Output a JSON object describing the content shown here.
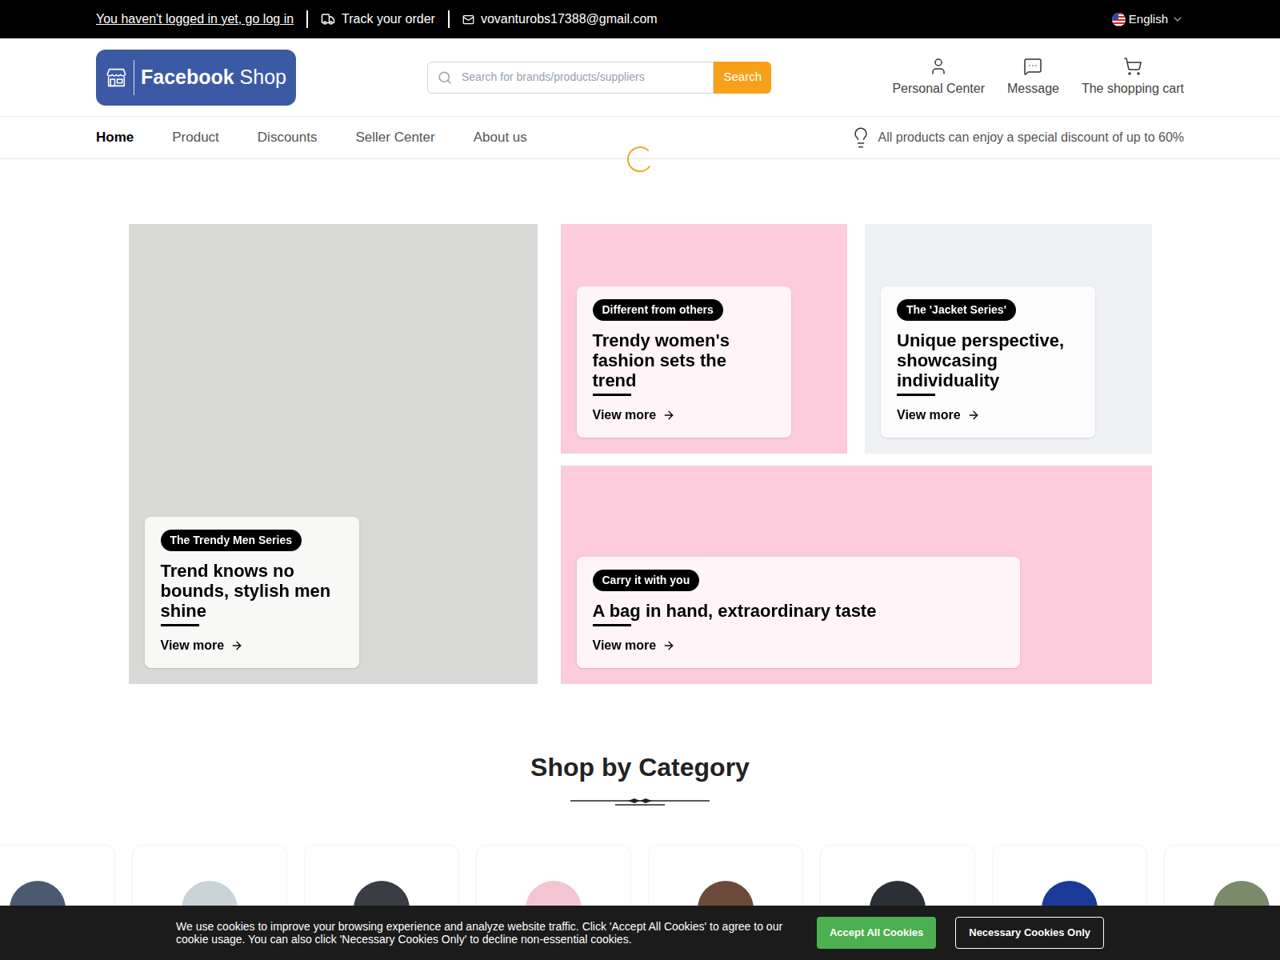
{
  "topbar": {
    "login": "You haven't logged in yet, go log in",
    "track": "Track your order",
    "email": "vovanturobs17388@gmail.com",
    "language": "English"
  },
  "logo": {
    "brand": "Facebook",
    "suffix": "Shop"
  },
  "search": {
    "placeholder": "Search for brands/products/suppliers",
    "button": "Search"
  },
  "header_actions": [
    "Personal Center",
    "Message",
    "The shopping cart"
  ],
  "nav": [
    {
      "label": "Home",
      "selected": true
    },
    {
      "label": "Product",
      "selected": false
    },
    {
      "label": "Discounts",
      "selected": false
    },
    {
      "label": "Seller Center",
      "selected": false
    },
    {
      "label": "About us",
      "selected": false
    }
  ],
  "promo": "All products can enjoy a special discount of up to 60%",
  "loading": true,
  "hero": [
    {
      "badge": "The Trendy Men Series",
      "title": "Trend knows no bounds, stylish men shine",
      "link": "View more",
      "color": "#d9d9d7"
    },
    {
      "badge": "Different from others",
      "title": "Trendy women's fashion sets the trend",
      "link": "View more",
      "color": "#fccbdc"
    },
    {
      "badge": "The 'Jacket Series'",
      "title": "Unique perspective, showcasing individuality",
      "link": "View more",
      "color": "#eef0f4"
    },
    {
      "badge": "Carry it with you",
      "title": "A bag in hand, extraordinary taste",
      "link": "View more",
      "color": "#fccbdc"
    }
  ],
  "category_heading": "Shop by Category",
  "categories": [
    {
      "kind": "photo"
    },
    {
      "kind": "photo"
    },
    {
      "kind": "photo"
    },
    {
      "kind": "photo"
    },
    {
      "kind": "photo"
    },
    {
      "kind": "photo"
    },
    {
      "kind": "photo"
    },
    {
      "kind": "photo"
    }
  ],
  "cookie": {
    "text": "We use cookies to improve your browsing experience and analyze website traffic. Click 'Accept All Cookies' to agree to our cookie usage. You can also click 'Necessary Cookies Only' to decline non-essential cookies.",
    "accept": "Accept All Cookies",
    "necessary": "Necessary Cookies Only"
  }
}
